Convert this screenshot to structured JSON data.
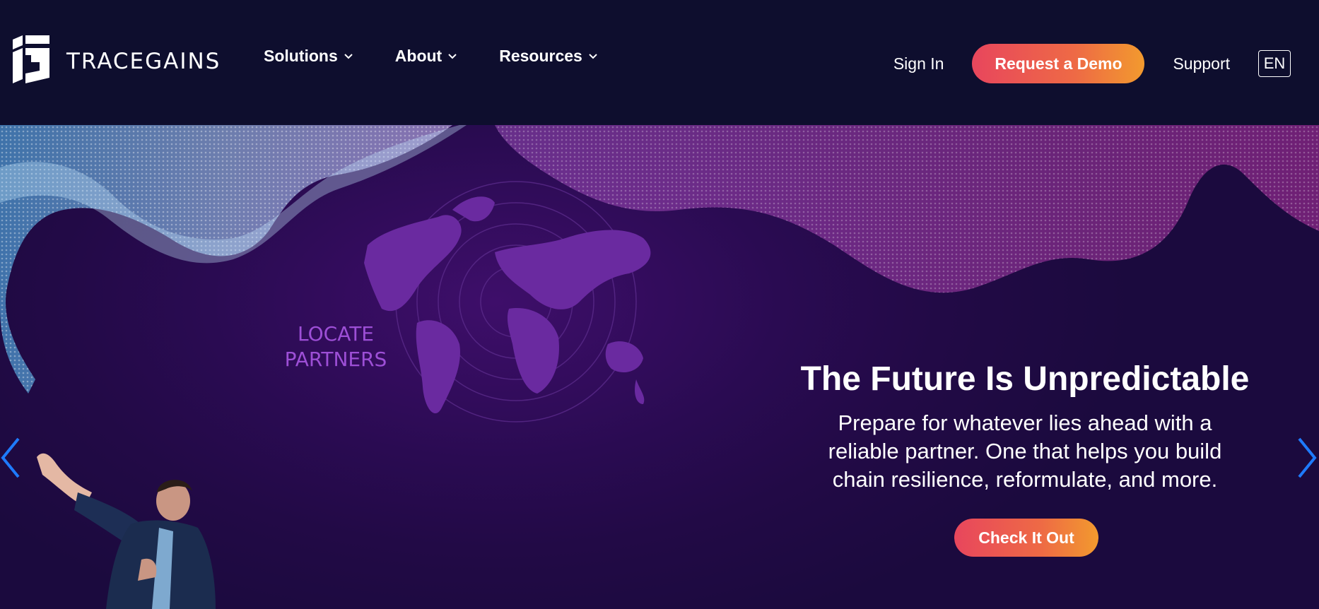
{
  "header": {
    "logo_text": "TRACEGAINS",
    "nav": [
      {
        "label": "Solutions"
      },
      {
        "label": "About"
      },
      {
        "label": "Resources"
      }
    ],
    "sign_in": "Sign In",
    "demo_button": "Request a Demo",
    "support": "Support",
    "language": "EN"
  },
  "hero": {
    "map_label_line1": "LOCATE",
    "map_label_line2": "PARTNERS",
    "headline": "The Future Is Unpredictable",
    "subtext_line1": "Prepare for whatever lies ahead with a",
    "subtext_line2": "reliable partner. One that helps you build",
    "subtext_line3": "chain resilience, reformulate, and more.",
    "cta_label": "Check It Out"
  },
  "icons": {
    "logo": "tracegains-logo-icon",
    "chevrons": "chevron-down-icon",
    "prev": "chevron-left-icon",
    "next": "chevron-right-icon"
  },
  "colors": {
    "header_bg": "#0e0e2e",
    "accent_gradient_start": "#e8465d",
    "accent_gradient_end": "#f29a2e",
    "map_color": "#6a2aa0",
    "locate_text": "#9d4fd6",
    "arrow_blue": "#1e7bff"
  }
}
